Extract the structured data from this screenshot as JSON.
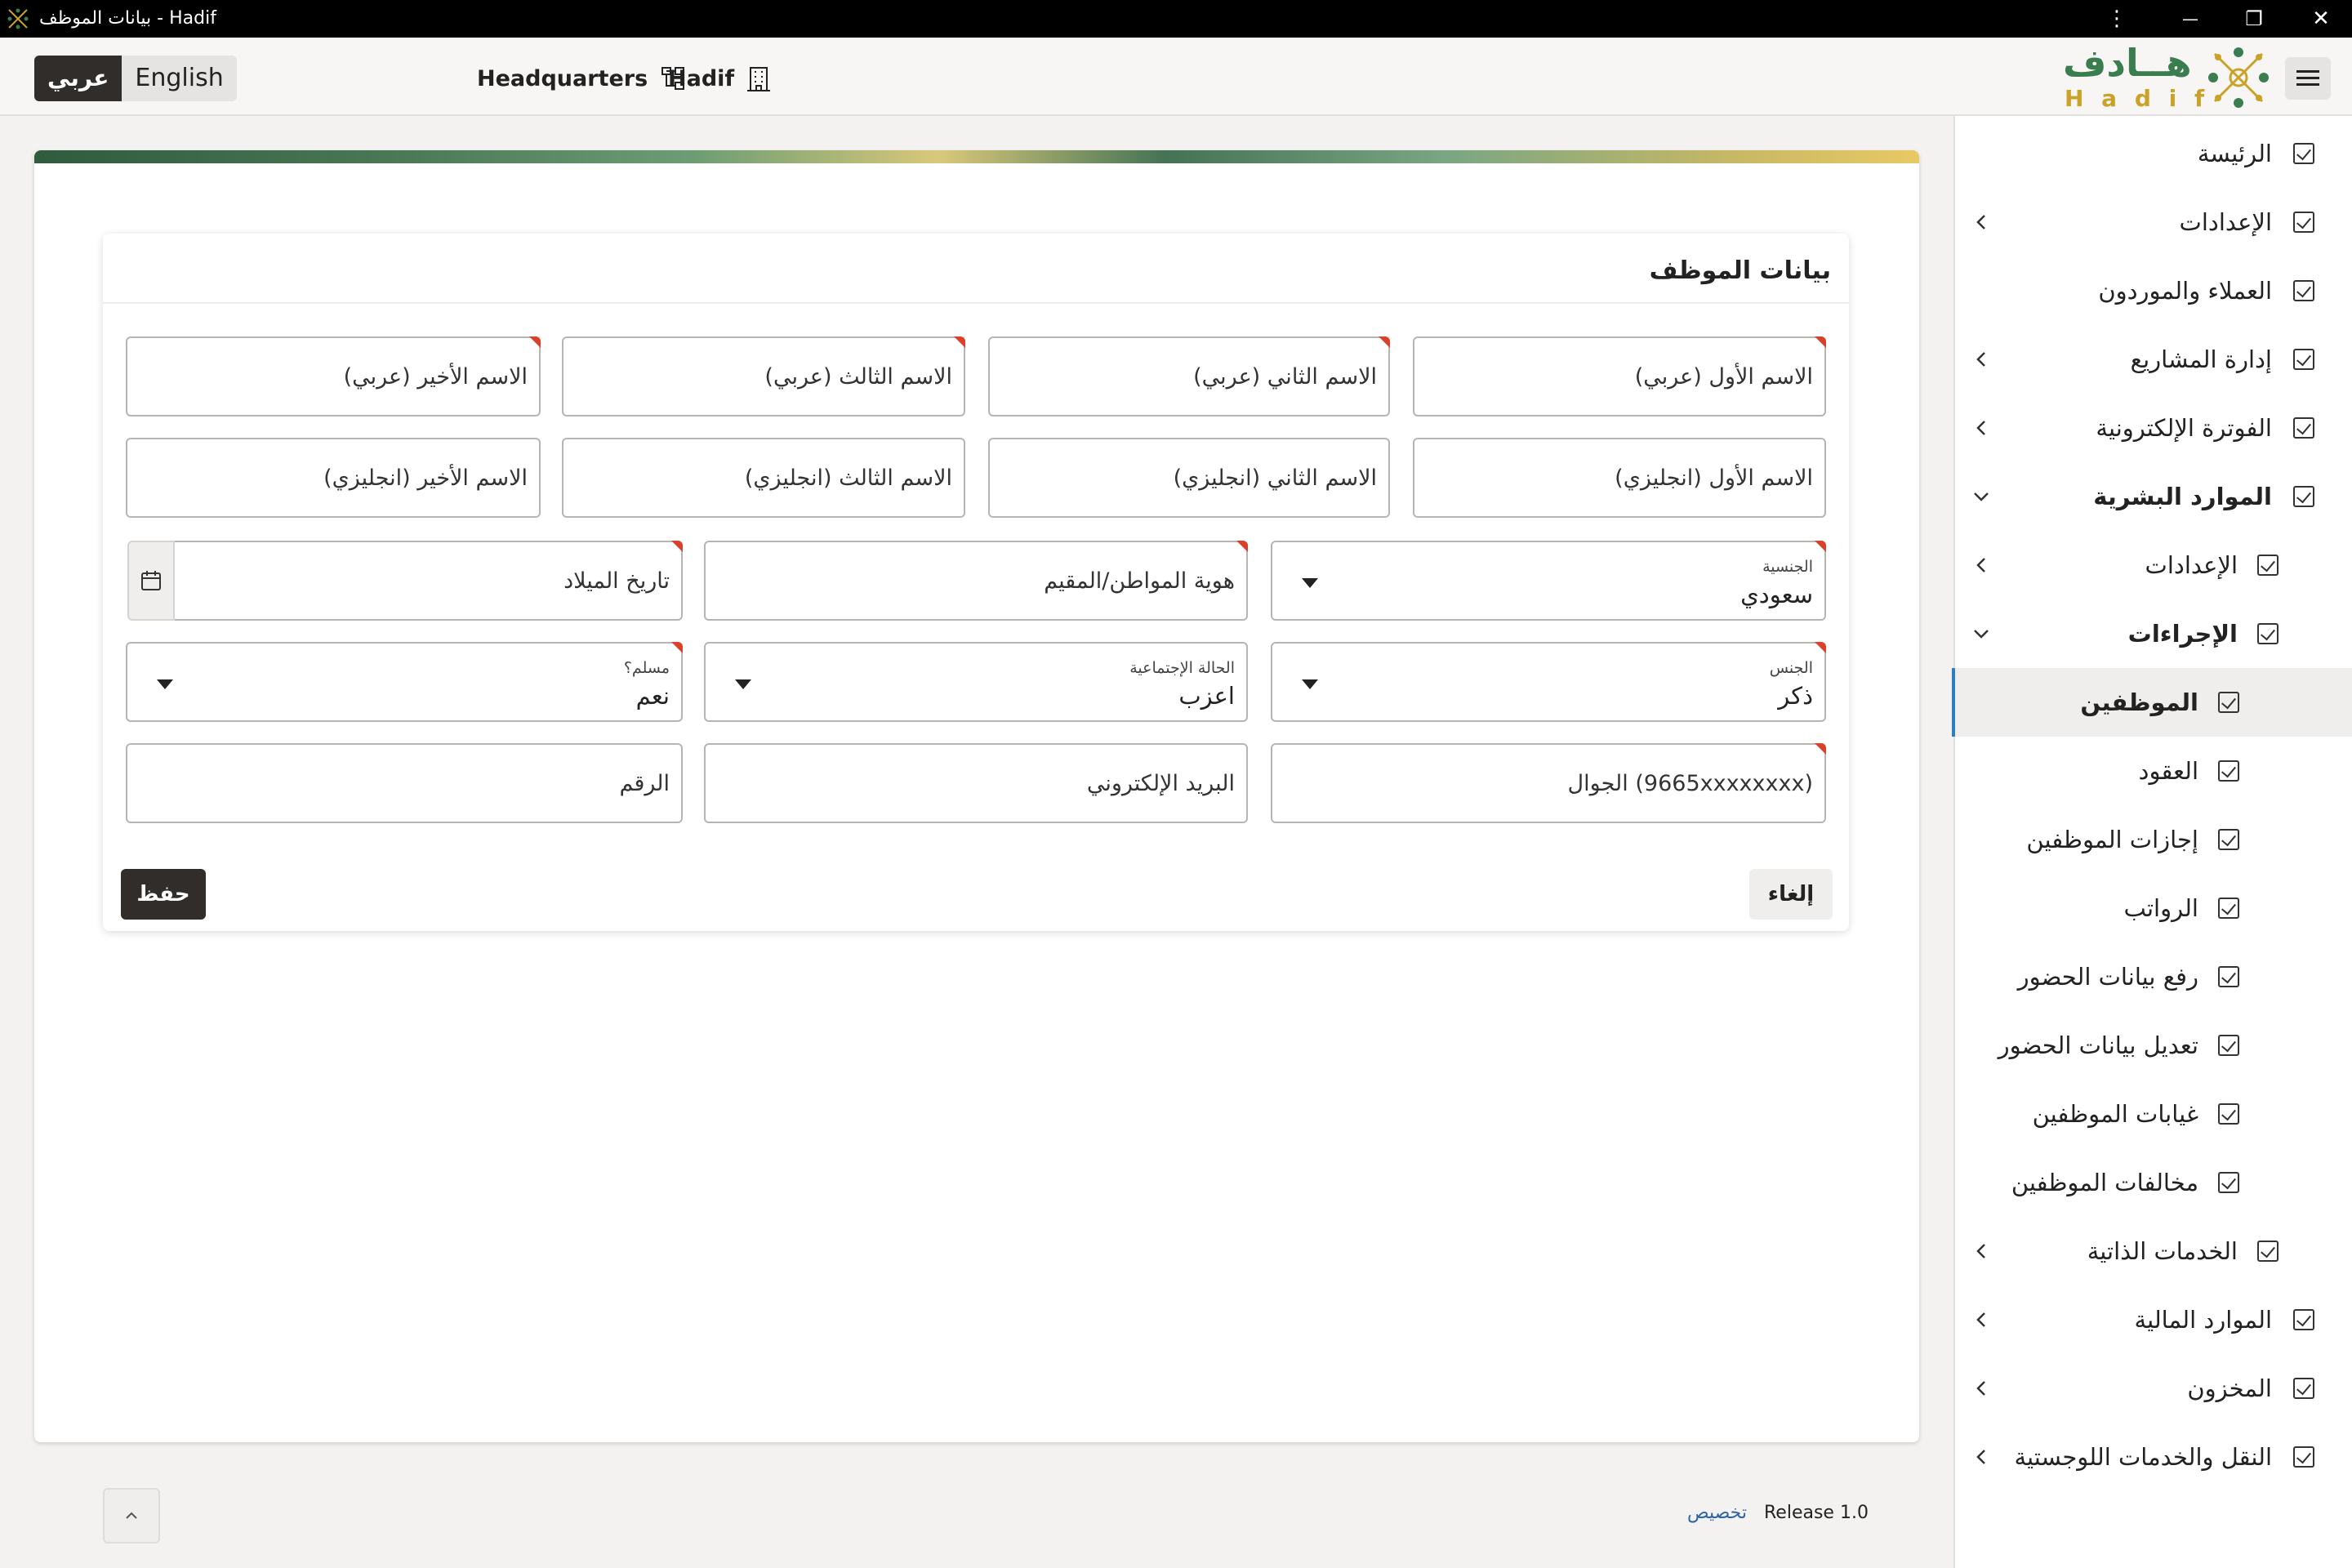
{
  "window": {
    "title": "بيانات الموظف - Hadif",
    "menu_glyph": "⋮",
    "minimize_glyph": "—",
    "restore_glyph": "❐",
    "close_glyph": "✕"
  },
  "header": {
    "lang_ar": "عربي",
    "lang_en": "English",
    "branch": "Headquarters",
    "company": "Hadif",
    "logo_ar": "هــادف",
    "logo_en": "H a d i f"
  },
  "sidebar": {
    "items": [
      {
        "label": "الرئيسة"
      },
      {
        "label": "الإعدادات"
      },
      {
        "label": "العملاء والموردون"
      },
      {
        "label": "إدارة المشاريع"
      },
      {
        "label": "الفوترة الإلكترونية"
      },
      {
        "label": "الموارد البشرية"
      },
      {
        "label": "الإعدادات"
      },
      {
        "label": "الإجراءات"
      },
      {
        "label": "الموظفين"
      },
      {
        "label": "العقود"
      },
      {
        "label": "إجازات الموظفين"
      },
      {
        "label": "الرواتب"
      },
      {
        "label": "رفع بيانات الحضور"
      },
      {
        "label": "تعديل بيانات الحضور"
      },
      {
        "label": "غيابات الموظفين"
      },
      {
        "label": "مخالفات الموظفين"
      },
      {
        "label": "الخدمات الذاتية"
      },
      {
        "label": "الموارد المالية"
      },
      {
        "label": "المخزون"
      },
      {
        "label": "النقل والخدمات اللوجستية"
      }
    ]
  },
  "form": {
    "title": "بيانات الموظف",
    "first_ar": "الاسم الأول (عربي)",
    "second_ar": "الاسم الثاني (عربي)",
    "third_ar": "الاسم الثالث (عربي)",
    "last_ar": "الاسم الأخير (عربي)",
    "first_en": "الاسم الأول (انجليزي)",
    "second_en": "الاسم الثاني (انجليزي)",
    "third_en": "الاسم الثالث (انجليزي)",
    "last_en": "الاسم الأخير (انجليزي)",
    "nationality_label": "الجنسية",
    "nationality_value": "سعودي",
    "national_id": "هوية المواطن/المقيم",
    "birth_date": "تاريخ الميلاد",
    "gender_label": "الجنس",
    "gender_value": "ذكر",
    "marital_label": "الحالة الإجتماعية",
    "marital_value": "اعزب",
    "muslim_label": "مسلم؟",
    "muslim_value": "نعم",
    "mobile": "الجوال (9665xxxxxxxx)",
    "email": "البريد الإلكتروني",
    "number": "الرقم",
    "cancel_label": "إلغاء",
    "save_label": "حفظ"
  },
  "footer": {
    "release": "Release 1.0",
    "customize": "تخصيص"
  },
  "colors": {
    "primary_dark": "#312d2a",
    "accent_blue": "#2f7ec2",
    "required_marker": "#d9412b",
    "logo_green": "#3a7d4f",
    "logo_gold": "#c9a227"
  }
}
